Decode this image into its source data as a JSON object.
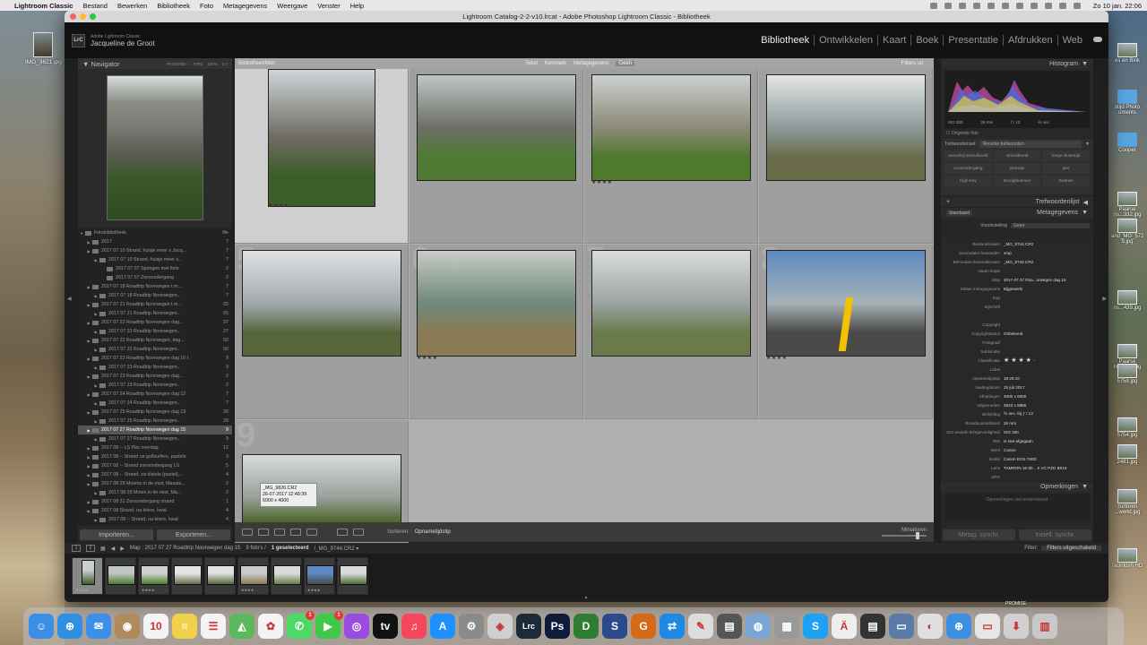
{
  "menubar": {
    "apple": "",
    "items": [
      "Lightroom Classic",
      "Bestand",
      "Bewerken",
      "Bibliotheek",
      "Foto",
      "Metagegevens",
      "Weergave",
      "Venster",
      "Help"
    ],
    "clock": "Zo 10 jan.  22:06"
  },
  "desktop": {
    "icon_label": "IMG_3621.jpg",
    "right_labels": [
      "es en Bink",
      "stijd Photo\numents",
      "Cooper",
      "Paarse\nns...332.jpg",
      "and_MG_572\n9.jpg",
      "ns...439.jpg",
      "Paarse\nns...526.jpg",
      "5758.jpg",
      "5754.jpg",
      "2481.jpg",
      "zurtoren\n...werkt.jpg",
      "facintosh HD"
    ]
  },
  "window": {
    "title": "Lightroom Catalog-2-2-v10.lrcat - Adobe Photoshop Lightroom Classic - Bibliotheek",
    "brand_small": "Adobe Lightroom Classic",
    "user": "Jacqueline de Groot",
    "logo": "LrC",
    "modules": [
      "Bibliotheek",
      "Ontwikkelen",
      "Kaart",
      "Boek",
      "Presentatie",
      "Afdrukken",
      "Web"
    ]
  },
  "navigator": {
    "title": "Navigator",
    "options": [
      "PASSEND ↕",
      "FIRS",
      "100%",
      "1:1"
    ]
  },
  "folders": {
    "root": "Fotobibliotheek",
    "root_size": "file",
    "rows": [
      {
        "label": "2017",
        "count": "7",
        "indent": 1,
        "sel": false
      },
      {
        "label": "2017 07 10 Strand, huisje meer x Jacq...",
        "count": "7",
        "indent": 1,
        "sel": false
      },
      {
        "label": "2017 07 10 Strand, huisje meer x...",
        "count": "7",
        "indent": 2,
        "sel": false
      },
      {
        "label": "2017 07 07 Springen met fiets",
        "count": "2",
        "indent": 3,
        "sel": false
      },
      {
        "label": "2017 07 07 Zonsondergang",
        "count": "2",
        "indent": 3,
        "sel": false
      },
      {
        "label": "2017 07 18 Roadtrip Noorwegen t.m...",
        "count": "7",
        "indent": 1,
        "sel": false
      },
      {
        "label": "2017 07 18 Roadtrip Noorwegen...",
        "count": "7",
        "indent": 2,
        "sel": false
      },
      {
        "label": "2017 07 21 Roadtrip Noorwegen t.m...",
        "count": "65",
        "indent": 1,
        "sel": false
      },
      {
        "label": "2017 07 21 Roadtrip Noorwegen...",
        "count": "65",
        "indent": 2,
        "sel": false
      },
      {
        "label": "2017 07 22 Roadtrip Noorwegen dag...",
        "count": "27",
        "indent": 1,
        "sel": false
      },
      {
        "label": "2017 07 22 Roadtrip Noorwegen...",
        "count": "27",
        "indent": 2,
        "sel": false
      },
      {
        "label": "2017 07 22 Roadtrip Noorwegen, dag...",
        "count": "50",
        "indent": 1,
        "sel": false
      },
      {
        "label": "2017 07 22 Roadtrip Noorwegen...",
        "count": "50",
        "indent": 2,
        "sel": false
      },
      {
        "label": "2017 07 23 Roadtrip Noorwegen dag 10 t",
        "count": "9",
        "indent": 1,
        "sel": false
      },
      {
        "label": "2017 07 23 Roadtrip Noorwegen...",
        "count": "9",
        "indent": 2,
        "sel": false
      },
      {
        "label": "2017 07 23 Roadtrip Noorwegen dag...",
        "count": "2",
        "indent": 1,
        "sel": false
      },
      {
        "label": "2017 07 23 Roadtrip Noorwegen...",
        "count": "2",
        "indent": 2,
        "sel": false
      },
      {
        "label": "2017 07 24 Roadtrip Noorwegen dag 12",
        "count": "7",
        "indent": 1,
        "sel": false
      },
      {
        "label": "2017 07 24 Roadtrip Noorwegen...",
        "count": "7",
        "indent": 2,
        "sel": false
      },
      {
        "label": "2017 07 25 Roadtrip Noorwegen dag 13",
        "count": "20",
        "indent": 1,
        "sel": false
      },
      {
        "label": "2017 07 25 Roadtrip Noorwegen...",
        "count": "20",
        "indent": 2,
        "sel": false
      },
      {
        "label": "2017 07 27 Roadtrip Noorwegen dag 15",
        "count": "9",
        "indent": 1,
        "sel": true
      },
      {
        "label": "2017 07 27 Roadtrip Noorwegen...",
        "count": "9",
        "indent": 2,
        "sel": false
      },
      {
        "label": "2017 08 -- LS Pier overdag",
        "count": "12",
        "indent": 1,
        "sel": false
      },
      {
        "label": "2017 08 -- Strand oa golfsurfers, pastels",
        "count": "3",
        "indent": 1,
        "sel": false
      },
      {
        "label": "2017 08 -- Strand zonsondergang LS",
        "count": "5",
        "indent": 1,
        "sel": false
      },
      {
        "label": "2017 08 -- Strand, oa distels (pastel),...",
        "count": "4",
        "indent": 1,
        "sel": false
      },
      {
        "label": "2017 08 28 Molens in de mist, Maasla...",
        "count": "2",
        "indent": 1,
        "sel": false
      },
      {
        "label": "2017 08 28 Molen in de mist, Ma...",
        "count": "2",
        "indent": 2,
        "sel": false
      },
      {
        "label": "2017 08 31 Zonsondergang strand",
        "count": "1",
        "indent": 1,
        "sel": false
      },
      {
        "label": "2017 08 Strand, oa kiters, kwal",
        "count": "4",
        "indent": 1,
        "sel": false
      },
      {
        "label": "2017 08 -- Strand, oa kiters, kwal",
        "count": "4",
        "indent": 2,
        "sel": false
      },
      {
        "label": "2017 09 02 Zonsondergang",
        "count": "1",
        "indent": 1,
        "sel": false
      }
    ],
    "import_label": "Importeren...",
    "export_label": "Exporteren..."
  },
  "filterbar": {
    "label": "Bibliotheekfilter:",
    "tabs": [
      "Tekst",
      "Kenmerk",
      "Metagegevens",
      "Geen"
    ],
    "right": "Filters uit"
  },
  "grid": {
    "cells": [
      {
        "num": "",
        "stars": "★★★★",
        "sel": true,
        "orient": "portrait",
        "colors": [
          "#cfd5d8",
          "#6e6a62",
          "#3d5e2a"
        ]
      },
      {
        "num": "",
        "stars": "",
        "sel": false,
        "orient": "landscape",
        "colors": [
          "#bfc6c5",
          "#6c6f66",
          "#4f7a33"
        ]
      },
      {
        "num": "",
        "stars": "★★★★",
        "sel": false,
        "orient": "landscape",
        "colors": [
          "#cdd2cf",
          "#8c8a78",
          "#4e7a2c"
        ]
      },
      {
        "num": "",
        "stars": "",
        "sel": false,
        "orient": "landscape",
        "colors": [
          "#e4e6e6",
          "#8d9a9a",
          "#6a6c4a"
        ]
      },
      {
        "num": "5",
        "stars": "",
        "sel": false,
        "orient": "landscape",
        "colors": [
          "#dfe1e2",
          "#a2aaae",
          "#56663a"
        ]
      },
      {
        "num": "6",
        "stars": "★★★★",
        "sel": false,
        "orient": "landscape",
        "colors": [
          "#c8ccc6",
          "#6f8a7a",
          "#8a7a55"
        ]
      },
      {
        "num": "7",
        "stars": "",
        "sel": false,
        "orient": "landscape",
        "colors": [
          "#d9dcdc",
          "#9ba3a3",
          "#6b7a4a"
        ]
      },
      {
        "num": "8",
        "stars": "★★★★",
        "sel": false,
        "orient": "landscape",
        "colors": [
          "#5c8ac2",
          "#a6b2b6",
          "#4a4a48"
        ]
      },
      {
        "num": "9",
        "stars": "",
        "sel": false,
        "orient": "landscape",
        "colors": [
          "#d8dbdc",
          "#9aa09c",
          "#4e6a30"
        ]
      }
    ],
    "tooltip": [
      "_MG_9826.CR2",
      "26-07-2017 12:48:39",
      "6000 x 4000"
    ]
  },
  "toolbar": {
    "sort_label": "Sorteren:",
    "sort_value": "Opnametijdstip",
    "thumbs_label": "Miniaturen"
  },
  "histogram": {
    "title": "Histogram",
    "meta": [
      "ISO 200",
      "26 mm",
      "f / 13",
      "⅙ sec"
    ],
    "original": "Originele foto"
  },
  "keywords": {
    "set_label": "Trefwoordenset",
    "set_value": "Recente trefwoorden",
    "items": [
      "eenzelvij strandbeeld",
      "strandbeeld",
      "lange sluitertijd",
      "zonsondergang",
      "strandje",
      "pier",
      "High Key",
      "Droogbloemen",
      "Zwanen"
    ],
    "list_title": "Trefwoordenlijst"
  },
  "metadata": {
    "title": "Metagegevens",
    "standard": "Standaard",
    "preset_label": "Voorinstelling",
    "preset_value": "Geen",
    "rows": [
      [
        "Bestandsnaam",
        "_MG_9744.CR2"
      ],
      [
        "Secundaire bestanden",
        "xmp"
      ],
      [
        "Behouden bestandsnaam",
        "_MG_9744.CR2"
      ],
      [
        "Naam kopie",
        ""
      ],
      [
        "Map",
        "2017 07 27 Roa...orwegen dag 15"
      ],
      [
        "Status metagegevens",
        "Bijgewerkt"
      ],
      [
        "Kop",
        ""
      ],
      [
        "Bijschrift",
        ""
      ],
      [
        "",
        ""
      ],
      [
        "Copyright",
        ""
      ],
      [
        "Copyrightstatus",
        "Onbekend"
      ],
      [
        "Fotograaf",
        ""
      ],
      [
        "Sublocatie",
        ""
      ],
      [
        "Classificatie",
        "★ ★ ★ ★ ·"
      ],
      [
        "Label",
        ""
      ],
      [
        "Opnametijdstip",
        "19:25:10"
      ],
      [
        "Vastlegdatum",
        "25 juli 2017"
      ],
      [
        "Afmetingen",
        "4000 x 6000"
      ],
      [
        "Uitgesneden",
        "3923 x 5885"
      ],
      [
        "Belichting",
        "⅙ sec. bij ƒ / 13"
      ],
      [
        "Brandpuntsafstand",
        "26 mm"
      ],
      [
        "ISO-waarde lichtgevoeligheid",
        "ISO 200"
      ],
      [
        "Flits",
        "Is niet afgegaan"
      ],
      [
        "Merk",
        "Canon"
      ],
      [
        "Model",
        "Canon EOS 760D"
      ],
      [
        "Lens",
        "TAMRON 16-30 ...II VC PZD B016"
      ],
      [
        "GPS",
        ""
      ]
    ],
    "comments_title": "Opmerkingen",
    "comments_placeholder": "Opmerkingen niet ondersteund",
    "sync_meta": "Metag. synchr.",
    "sync_settings": "Instell. synchr."
  },
  "filmstrip": {
    "page1": "1",
    "page2": "2",
    "path": "Map : 2017 07 27 Roadtrip Noorwegen dag 15",
    "count": "9 foto's /",
    "selected": "1 geselecteerd",
    "file": "/_MG_9744.CR2 ▾",
    "filter_label": "Filter:",
    "filter_value": "Filters uitgeschakeld",
    "thumbs": [
      {
        "stars": "★★★★",
        "sel": true,
        "c1": "#c9cfd2",
        "c2": "#3e5c2c"
      },
      {
        "stars": "",
        "sel": false,
        "c1": "#bfc6c5",
        "c2": "#4f7a33"
      },
      {
        "stars": "★★★★",
        "sel": false,
        "c1": "#cdd2cf",
        "c2": "#4e7a2c"
      },
      {
        "stars": "",
        "sel": false,
        "c1": "#e4e6e6",
        "c2": "#6a6c4a"
      },
      {
        "stars": "",
        "sel": false,
        "c1": "#dfe1e2",
        "c2": "#56663a"
      },
      {
        "stars": "★★★★",
        "sel": false,
        "c1": "#c8ccc6",
        "c2": "#8a7a55"
      },
      {
        "stars": "",
        "sel": false,
        "c1": "#d9dcdc",
        "c2": "#6b7a4a"
      },
      {
        "stars": "★★★★",
        "sel": false,
        "c1": "#5c8ac2",
        "c2": "#4a4a48"
      },
      {
        "stars": "",
        "sel": false,
        "c1": "#d8dbdc",
        "c2": "#4e6a30"
      }
    ]
  },
  "dock": {
    "apps": [
      {
        "name": "finder",
        "glyph": "☺",
        "color": "#3a8ee6"
      },
      {
        "name": "safari",
        "glyph": "⊕",
        "color": "#2f8fe0"
      },
      {
        "name": "mail",
        "glyph": "✉",
        "color": "#3c90e8"
      },
      {
        "name": "contacts",
        "glyph": "◉",
        "color": "#b08a5a"
      },
      {
        "name": "calendar",
        "glyph": "10",
        "color": "#f4f4f4"
      },
      {
        "name": "notes",
        "glyph": "≡",
        "color": "#f2d04a"
      },
      {
        "name": "reminders",
        "glyph": "☰",
        "color": "#f4f4f4"
      },
      {
        "name": "maps",
        "glyph": "◭",
        "color": "#5cb85c"
      },
      {
        "name": "photos",
        "glyph": "✿",
        "color": "#f4f4f4"
      },
      {
        "name": "messages",
        "glyph": "✆",
        "color": "#4cd964",
        "badge": "1"
      },
      {
        "name": "facetime",
        "glyph": "▶",
        "color": "#3fc84a",
        "badge": "1"
      },
      {
        "name": "podcasts",
        "glyph": "◎",
        "color": "#9b4ce0"
      },
      {
        "name": "tv",
        "glyph": "tv",
        "color": "#111"
      },
      {
        "name": "music",
        "glyph": "♫",
        "color": "#f5465c"
      },
      {
        "name": "app-store",
        "glyph": "A",
        "color": "#1e90ff"
      },
      {
        "name": "system-preferences",
        "glyph": "⚙",
        "color": "#8a8a8a"
      },
      {
        "name": "disk-utility",
        "glyph": "◈",
        "color": "#d0d0d0"
      },
      {
        "name": "lightroom",
        "glyph": "Lrc",
        "color": "#1d2a3a"
      },
      {
        "name": "photoshop",
        "glyph": "Ps",
        "color": "#0d1c38"
      },
      {
        "name": "dashlane",
        "glyph": "D",
        "color": "#2e7d32"
      },
      {
        "name": "scrivener",
        "glyph": "S",
        "color": "#2b4a8a"
      },
      {
        "name": "gimp",
        "glyph": "G",
        "color": "#d46a1a"
      },
      {
        "name": "teamviewer",
        "glyph": "⇄",
        "color": "#1e88e5"
      },
      {
        "name": "preview",
        "glyph": "✎",
        "color": "#dcdcdc"
      },
      {
        "name": "printer1",
        "glyph": "▤",
        "color": "#555"
      },
      {
        "name": "network",
        "glyph": "◍",
        "color": "#7aa6d6"
      },
      {
        "name": "printer2",
        "glyph": "▦",
        "color": "#999"
      },
      {
        "name": "skype",
        "glyph": "S",
        "color": "#1da1f2"
      },
      {
        "name": "font-book",
        "glyph": "Ä",
        "color": "#eee"
      },
      {
        "name": "printer3",
        "glyph": "▤",
        "color": "#333"
      },
      {
        "name": "drive",
        "glyph": "▭",
        "color": "#5a7aa8"
      },
      {
        "name": "color-sync",
        "glyph": "◐",
        "color": "#e0e0e0"
      },
      {
        "name": "safari2",
        "glyph": "⊕",
        "color": "#3d8fe3"
      },
      {
        "name": "files",
        "glyph": "▭",
        "color": "#e6e6e6"
      },
      {
        "name": "downloads",
        "glyph": "⬇",
        "color": "#d0d0d0"
      },
      {
        "name": "trash",
        "glyph": "▥",
        "color": "#c8c8c8"
      }
    ],
    "promise_label": "PROMISE"
  }
}
